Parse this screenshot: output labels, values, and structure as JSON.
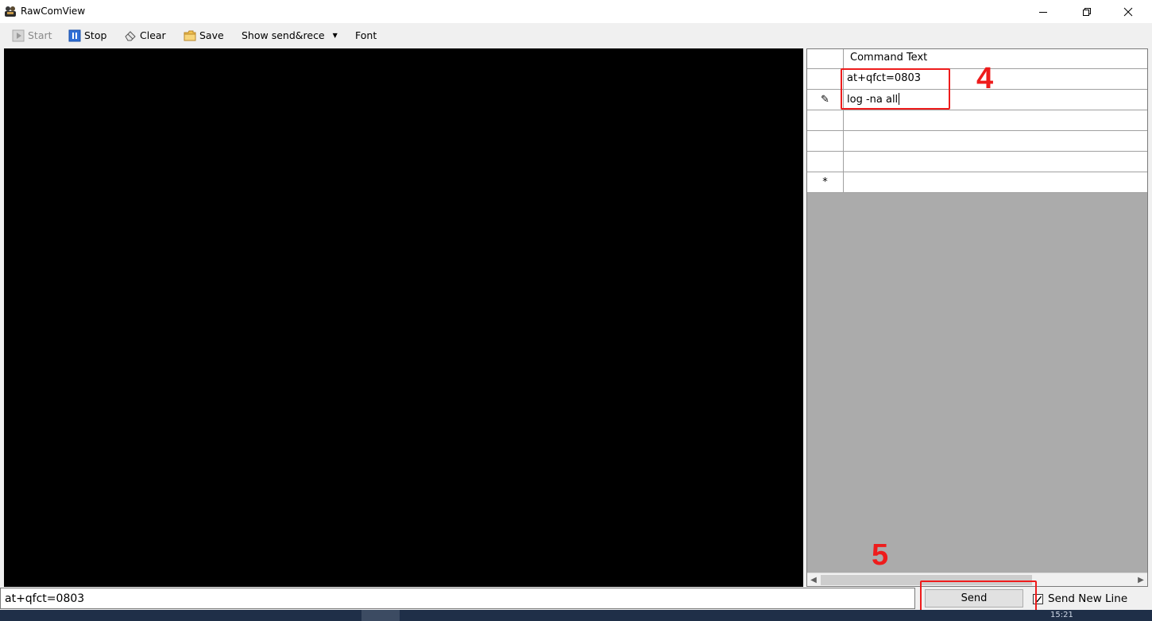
{
  "window": {
    "title": "RawComView",
    "app_icon": "rawcomview-app-icon",
    "controls": [
      "minimize-icon",
      "restore-icon",
      "close-icon"
    ]
  },
  "toolbar": {
    "start_label": "Start",
    "stop_label": "Stop",
    "clear_label": "Clear",
    "save_label": "Save",
    "show_dropdown_label": "Show send&rece",
    "font_label": "Font",
    "icons": {
      "start": "play-icon",
      "stop": "pause-icon",
      "clear": "eraser-icon",
      "save": "folder-icon"
    }
  },
  "output": {
    "text": ""
  },
  "command_grid": {
    "column_header": "Command Text",
    "rows": [
      {
        "indicator": "",
        "text": "at+qfct=0803"
      },
      {
        "indicator": "✎",
        "text": "log -na all",
        "editing": true
      },
      {
        "indicator": "",
        "text": ""
      },
      {
        "indicator": "",
        "text": ""
      },
      {
        "indicator": "",
        "text": ""
      },
      {
        "indicator": "*",
        "text": "",
        "new_row": true
      }
    ]
  },
  "bottom_bar": {
    "command_value": "at+qfct=0803",
    "send_label": "Send",
    "send_new_line_label": "Send New Line",
    "send_new_line_checked": true
  },
  "annotations": {
    "label_4": "4",
    "label_5": "5",
    "color": "#ee1c1c"
  },
  "taskbar": {
    "clock_partial": "15:21"
  }
}
